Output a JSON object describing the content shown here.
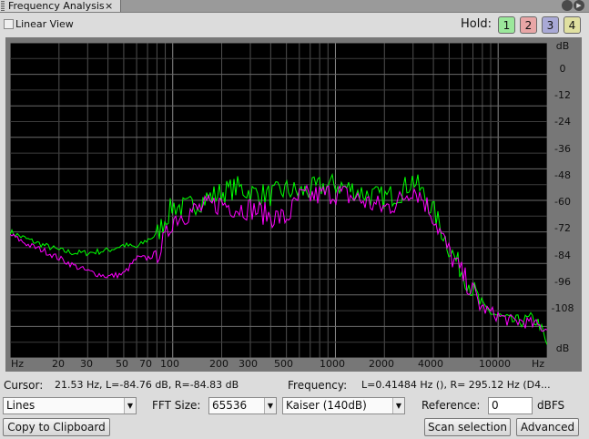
{
  "tab": {
    "title": "Frequency Analysis",
    "close_glyph": "×",
    "menu_glyph": "▶"
  },
  "options": {
    "linear_view_label": "Linear View",
    "linear_view_checked": false
  },
  "hold": {
    "label": "Hold:",
    "buttons": [
      "1",
      "2",
      "3",
      "4"
    ],
    "colors": [
      "#9be89b",
      "#e8a6a6",
      "#a9a9d6",
      "#e0e0a0"
    ]
  },
  "plot": {
    "y_labels": [
      "dB",
      "0",
      "-12",
      "-24",
      "-36",
      "-48",
      "-60",
      "-72",
      "-84",
      "-96",
      "-108",
      "dB"
    ],
    "x_labels": [
      "Hz",
      "20",
      "30",
      "50",
      "70",
      "100",
      "200",
      "300",
      "500",
      "1000",
      "2000",
      "4000",
      "10000",
      "Hz"
    ],
    "series_colors": [
      "#00ff00",
      "#ff00ff"
    ]
  },
  "info": {
    "cursor_label": "Cursor:",
    "cursor_value": "21.53 Hz, L=-84.76 dB, R=-84.83 dB",
    "frequency_label": "Frequency:",
    "frequency_value": "L=0.41484 Hz (), R= 295.12 Hz (D4..."
  },
  "controls": {
    "mode_value": "Lines",
    "fft_label": "FFT Size:",
    "fft_value": "65536",
    "window_value": "Kaiser (140dB)",
    "reference_label": "Reference:",
    "reference_value": "0",
    "reference_unit": "dBFS",
    "copy_label": "Copy to Clipboard",
    "scan_label": "Scan selection",
    "advanced_label": "Advanced"
  },
  "chart_data": {
    "type": "line",
    "xscale": "log",
    "xlim": [
      10,
      20000
    ],
    "ylim": [
      -120,
      0
    ],
    "xlabel": "Hz",
    "ylabel": "dB",
    "grid": true,
    "series": [
      {
        "color": "#00ff00",
        "x": [
          10,
          13,
          16,
          20,
          25,
          30,
          40,
          50,
          60,
          70,
          80,
          90,
          100,
          120,
          150,
          200,
          250,
          300,
          400,
          500,
          600,
          800,
          1000,
          1300,
          1600,
          2000,
          2500,
          3000,
          3500,
          4000,
          5000,
          6000,
          7000,
          8000,
          10000,
          12000,
          14000,
          16000,
          18000,
          20000
        ],
        "y": [
          -72,
          -75,
          -77,
          -79,
          -80,
          -80,
          -79,
          -77,
          -78,
          -75,
          -73,
          -67,
          -62,
          -63,
          -60,
          -57,
          -55,
          -57,
          -58,
          -56,
          -57,
          -55,
          -54,
          -56,
          -58,
          -59,
          -57,
          -52,
          -58,
          -64,
          -78,
          -87,
          -94,
          -101,
          -104,
          -106,
          -106,
          -105,
          -107,
          -116
        ]
      },
      {
        "color": "#ff00ff",
        "x": [
          10,
          13,
          16,
          20,
          25,
          30,
          40,
          50,
          60,
          70,
          80,
          90,
          100,
          120,
          150,
          200,
          250,
          300,
          400,
          500,
          600,
          800,
          1000,
          1300,
          1600,
          2000,
          2500,
          3000,
          3500,
          4000,
          5000,
          6000,
          7000,
          8000,
          10000,
          12000,
          14000,
          16000,
          18000,
          20000
        ],
        "y": [
          -73,
          -77,
          -79,
          -82,
          -85,
          -87,
          -89,
          -88,
          -82,
          -82,
          -80,
          -75,
          -67,
          -65,
          -63,
          -61,
          -63,
          -63,
          -66,
          -67,
          -59,
          -58,
          -57,
          -59,
          -61,
          -63,
          -60,
          -55,
          -60,
          -66,
          -80,
          -88,
          -95,
          -101,
          -104,
          -106,
          -106,
          -107,
          -108,
          -109
        ]
      }
    ]
  }
}
